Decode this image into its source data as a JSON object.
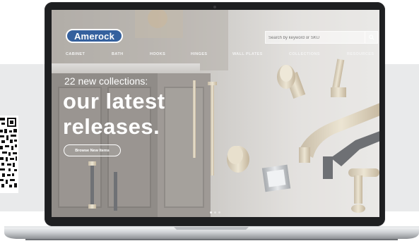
{
  "brand": {
    "logo_text": "Amerock",
    "accent": "#1e529b"
  },
  "search": {
    "placeholder": "Search by keyword or SKU",
    "icon": "search-icon"
  },
  "nav": {
    "items": [
      "CABINET",
      "BATH",
      "HOOKS",
      "HINGES",
      "WALL PLATES",
      "COLLECTIONS",
      "RESOURCES"
    ]
  },
  "hero": {
    "subtitle": "22 new collections:",
    "headline_line1": "our latest",
    "headline_line2": "releases.",
    "cta_label": "Browse New Items"
  },
  "carousel": {
    "slide_count": 3,
    "active_index": 0
  },
  "colors": {
    "band": "#e9eaeb",
    "laptop_bezel": "#1e1f21",
    "hero_text": "#ffffff"
  }
}
